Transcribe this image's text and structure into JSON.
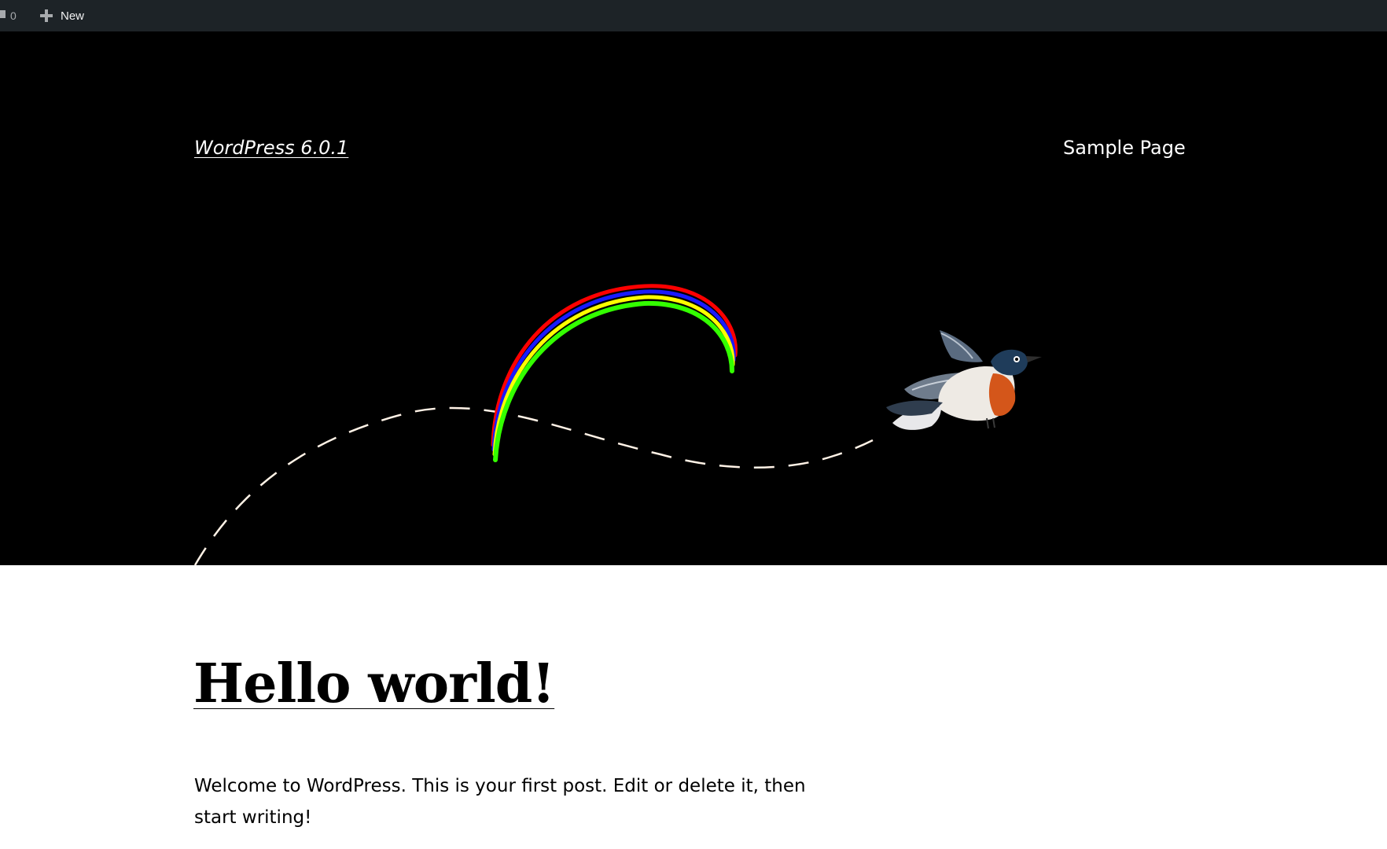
{
  "adminbar": {
    "comments_count": "0",
    "new_label": "New",
    "icons": {
      "comments": "comment-bubble-icon",
      "new": "plus-icon"
    }
  },
  "header": {
    "site_title": "WordPress 6.0.1",
    "nav": [
      {
        "label": "Sample Page"
      }
    ],
    "art": {
      "description_icons": [
        "rainbow-arc",
        "dashed-flight-path",
        "bird-illustration"
      ]
    }
  },
  "post": {
    "title": "Hello world!",
    "body": "Welcome to WordPress. This is your first post. Edit or delete it, then start writing!"
  },
  "colors": {
    "adminbar_bg": "#1d2327",
    "header_bg": "#000000",
    "rainbow_red": "#ff0000",
    "rainbow_blue": "#1a1aff",
    "rainbow_yellow": "#ffff00",
    "rainbow_green": "#33ff00",
    "path": "#fff2e6"
  }
}
